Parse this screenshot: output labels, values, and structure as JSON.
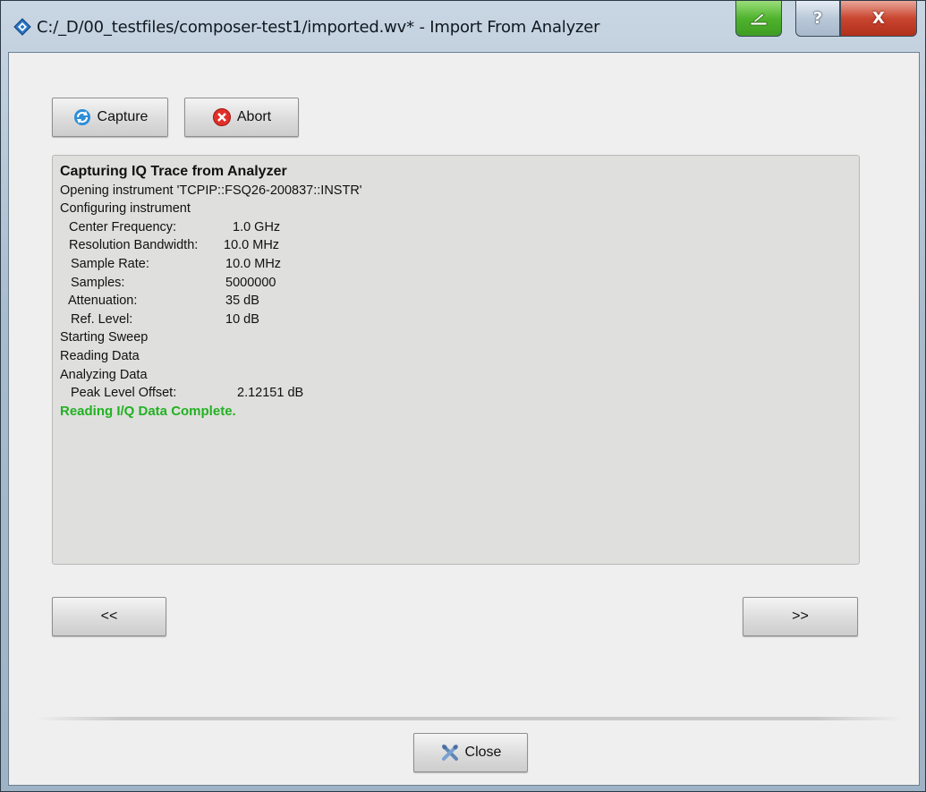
{
  "window": {
    "title": "C:/_D/00_testfiles/composer-test1/imported.wv* - Import From Analyzer"
  },
  "toolbar": {
    "capture_label": "Capture",
    "abort_label": "Abort"
  },
  "log": {
    "heading": "Capturing IQ Trace from Analyzer",
    "opening": "Opening instrument 'TCPIP::FSQ26-200837::INSTR'",
    "configuring": "Configuring instrument",
    "settings": [
      {
        "label": "Center Frequency:",
        "value": "1.0 GHz"
      },
      {
        "label": "Resolution Bandwidth:",
        "value": "10.0 MHz"
      },
      {
        "label": "Sample Rate:",
        "value": "10.0 MHz"
      },
      {
        "label": "Samples:",
        "value": "5000000"
      },
      {
        "label": "Attenuation:",
        "value": "35 dB"
      },
      {
        "label": "Ref. Level:",
        "value": "10 dB"
      }
    ],
    "starting_sweep": "Starting Sweep",
    "reading_data": "Reading Data",
    "analyzing_data": "Analyzing Data",
    "peak": {
      "label": "Peak Level Offset:",
      "value": "2.12151 dB"
    },
    "complete": "Reading I/Q Data Complete.",
    "complete_color": "#22b122"
  },
  "nav": {
    "prev_label": "<<",
    "next_label": ">>"
  },
  "footer": {
    "close_label": "Close"
  },
  "icons": {
    "app": "diamond-app-icon",
    "capture": "refresh-icon",
    "abort": "abort-icon",
    "close": "tools-close-icon"
  }
}
